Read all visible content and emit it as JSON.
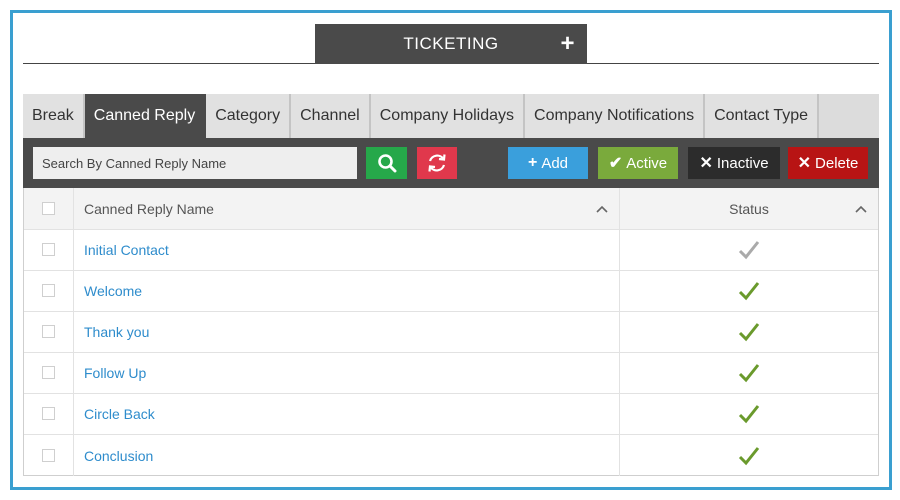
{
  "header": {
    "title": "TICKETING",
    "plus_label": "+"
  },
  "tabs": [
    {
      "label": "Break"
    },
    {
      "label": "Canned Reply",
      "active": true
    },
    {
      "label": "Category"
    },
    {
      "label": "Channel"
    },
    {
      "label": "Company Holidays"
    },
    {
      "label": "Company Notifications"
    },
    {
      "label": "Contact Type"
    }
  ],
  "toolbar": {
    "search_placeholder": "Search By Canned Reply Name",
    "search_icon": "search-icon",
    "refresh_icon": "refresh-icon",
    "add_label": "Add",
    "active_label": "Active",
    "inactive_label": "Inactive",
    "delete_label": "Delete"
  },
  "table": {
    "columns": {
      "name": "Canned Reply Name",
      "status": "Status"
    },
    "rows": [
      {
        "name": "Initial Contact",
        "status": "inactive"
      },
      {
        "name": "Welcome",
        "status": "active"
      },
      {
        "name": "Thank you",
        "status": "active"
      },
      {
        "name": "Follow Up",
        "status": "active"
      },
      {
        "name": "Circle Back",
        "status": "active"
      },
      {
        "name": "Conclusion",
        "status": "active"
      }
    ]
  },
  "colors": {
    "accent": "#3a9fdc",
    "dark": "#4a4a4a",
    "active_check": "#6a9a2c",
    "inactive_check": "#aaaaaa",
    "link": "#2e8ccc"
  }
}
